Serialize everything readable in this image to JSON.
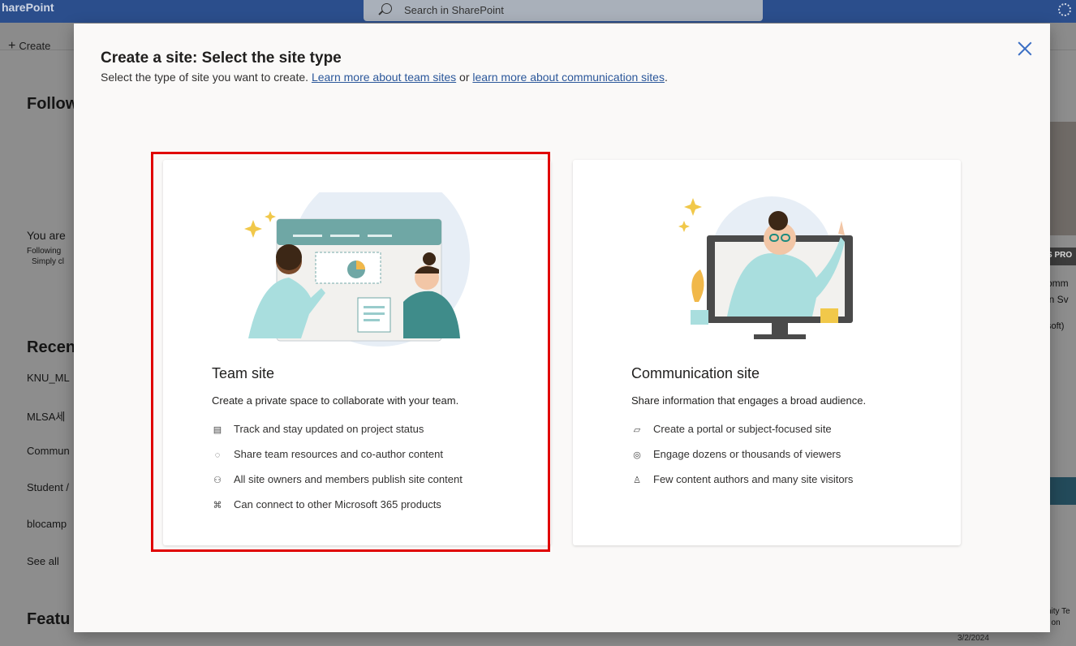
{
  "topbar": {
    "brand": "harePoint",
    "search_placeholder": "Search in SharePoint"
  },
  "background": {
    "create_label": "Create",
    "followed_heading": "Follow",
    "empty_title": "You are",
    "empty_line1": "Following",
    "empty_line2": "Simply cl",
    "recent_heading": "Recen",
    "recent_items": [
      "KNU_ML",
      "MLSA세",
      "Commun",
      "Student /",
      "blocamp"
    ],
    "see_all": "See all",
    "featured_heading": "Featu",
    "right_snippets": [
      "S PRO",
      "omm",
      "in Sv",
      "soft)",
      "nity Te",
      "t on"
    ],
    "bottom_date": "3/2/2024"
  },
  "modal": {
    "title": "Create a site: Select the site type",
    "subtitle_prefix": "Select the type of site you want to create. ",
    "link_team": "Learn more about team sites",
    "subtitle_mid": " or ",
    "link_comm": "learn more about communication sites",
    "subtitle_suffix": ".",
    "cards": {
      "team": {
        "title": "Team site",
        "description": "Create a private space to collaborate with your team.",
        "features": [
          {
            "icon": "clipboard-icon",
            "text": "Track and stay updated on project status"
          },
          {
            "icon": "share-circle-icon",
            "text": "Share team resources and co-author content"
          },
          {
            "icon": "people-icon",
            "text": "All site owners and members publish site content"
          },
          {
            "icon": "connect-icon",
            "text": "Can connect to other Microsoft 365 products"
          }
        ]
      },
      "comm": {
        "title": "Communication site",
        "description": "Share information that engages a broad audience.",
        "features": [
          {
            "icon": "edit-page-icon",
            "text": "Create a portal or subject-focused site"
          },
          {
            "icon": "broadcast-icon",
            "text": "Engage dozens or thousands of viewers"
          },
          {
            "icon": "person-visitor-icon",
            "text": "Few content authors and many site visitors"
          }
        ]
      }
    }
  },
  "colors": {
    "accent": "#2b579a",
    "highlight": "#e00000",
    "topbar": "#2b4e8c"
  }
}
